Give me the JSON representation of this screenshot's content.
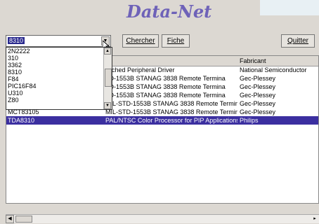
{
  "app": {
    "title": "Data-Net"
  },
  "search": {
    "value": "8310"
  },
  "buttons": {
    "search": "Chercher",
    "sheet": "Fiche",
    "quit": "Quitter"
  },
  "dropdown": {
    "items": [
      "2N2222",
      "310",
      "3362",
      "8310",
      "F84",
      "PIC16F84",
      "U310",
      "Z80"
    ]
  },
  "table": {
    "headers": [
      "",
      "n",
      "Fabricant"
    ],
    "rows": [
      {
        "part": "",
        "desc": "vitched Peripheral Driver",
        "maker": "National Semiconductor"
      },
      {
        "part": "",
        "desc": "TD-1553B STANAG 3838 Remote Termina",
        "maker": "Gec-Plessey"
      },
      {
        "part": "",
        "desc": "TD-1553B STANAG 3838 Remote Termina",
        "maker": "Gec-Plessey"
      },
      {
        "part": "",
        "desc": "TD-1553B STANAG 3838 Remote Termina",
        "maker": "Gec-Plessey"
      },
      {
        "part": "MCT83105",
        "desc": "MIL-STD-1553B STANAG 3838 Remote Termina",
        "maker": "Gec-Plessey"
      },
      {
        "part": "MCT83105",
        "desc": "MIL-STD-1553B STANAG 3838 Remote Termina",
        "maker": "Gec-Plessey"
      },
      {
        "part": "TDA8310",
        "desc": "PAL/NTSC Color Processor for PIP Applications",
        "maker": "Philips",
        "selected": true
      }
    ]
  },
  "colors": {
    "selection": "#3b2fa0",
    "title": "#6e62b8",
    "window": "#dcd8d2"
  }
}
